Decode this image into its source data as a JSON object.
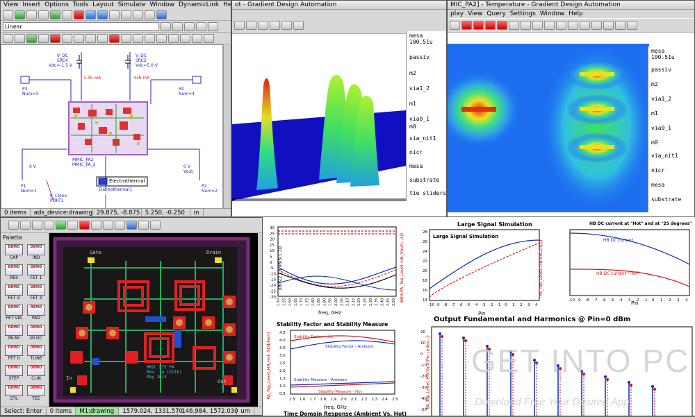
{
  "schematic": {
    "menu": [
      "View",
      "Insert",
      "Options",
      "Tools",
      "Layout",
      "Simulate",
      "Window",
      "DynamicLink",
      "Help"
    ],
    "mode_select": "Linear",
    "labels": {
      "vdc1": "V_DC",
      "src4": "SRC4",
      "vdc1v": "Vdc=-1.5 V",
      "vdc2": "V_DC",
      "src2": "SRC2",
      "vdc2v": "Vdc=5.0 V",
      "cur1": "1.35 mA",
      "cur2": "436 mA",
      "p3": "P3",
      "num3": "Num=3",
      "p4": "P4",
      "num4": "Num=4",
      "p1": "P1",
      "num1": "Num=1",
      "p2": "P2",
      "num2": "Num=2",
      "mmic": "MMIC_PA2",
      "mmic2": "MMIC_PA_2",
      "electro": "Electrothermal",
      "electro_sub": "Electrothermal1",
      "vin": "0 V",
      "vout": "0 V",
      "vout_lbl": "Vout",
      "p1tone": "P_1Tone",
      "port1": "PORT1"
    },
    "status": [
      "0 items",
      "ads_device:drawing",
      "29.875, -8.875",
      "5.250, -0.250",
      "in"
    ]
  },
  "thermal3d": {
    "title": "ot - Gradient Design Automation",
    "layers": [
      "mesa",
      "100.51u",
      "passiv",
      "m2",
      "via1_2",
      "m1",
      "via0_1",
      "m0",
      "via_nit1",
      "nicr",
      "mesa",
      "substrate",
      "tie sliders"
    ]
  },
  "temperature": {
    "title": "MIC_PA2] - Temperature - Gradient Design Automation",
    "menu": [
      "play",
      "View",
      "Query",
      "Settings",
      "Window",
      "Help"
    ],
    "layers": [
      "mesa",
      "100.51u",
      "passiv",
      "m2",
      "via1_2",
      "m1",
      "via0_1",
      "m0",
      "via_nit1",
      "nicr",
      "mesa",
      "substrate"
    ]
  },
  "layout": {
    "palette_title": "Palette",
    "palette": [
      {
        "icon": "DEMO",
        "label": "CAP"
      },
      {
        "icon": "DEMO",
        "label": "IND"
      },
      {
        "icon": "DEMO",
        "label": "RES"
      },
      {
        "icon": "DEMO",
        "label": "FET 1"
      },
      {
        "icon": "DEMO",
        "label": "FET 2"
      },
      {
        "icon": "DEMO",
        "label": "FET 3"
      },
      {
        "icon": "DEMO",
        "label": "FET VIA"
      },
      {
        "icon": "DEMO",
        "label": "PAD"
      },
      {
        "icon": "DEMO",
        "label": "MI-MI"
      },
      {
        "icon": "DEMO",
        "label": "MI DC"
      },
      {
        "icon": "DEMO",
        "label": "FET 0"
      },
      {
        "icon": "DEMO",
        "label": "TLINE"
      },
      {
        "icon": "DEMO",
        "label": "STEP"
      },
      {
        "icon": "DEMO",
        "label": "CLIN"
      },
      {
        "icon": "DEMO",
        "label": "CFIL"
      },
      {
        "icon": "DEMO",
        "label": "TEE"
      }
    ],
    "chip_text": [
      "Gate",
      "Drain",
      "In",
      "Out",
      "MMIC LTE PA",
      "Rev. 2a (Silk)",
      "May 2013"
    ],
    "status": [
      "Select: Enter",
      "0 items",
      "M1:drawing",
      "1579.024, 1331.570",
      "146.984, 1572.030",
      "um"
    ]
  },
  "plots": {
    "p1": {
      "xlabel": "freq, GHz",
      "ticks_x": [
        "1.50",
        "1.55",
        "1.60",
        "1.65",
        "1.70",
        "1.75",
        "1.80",
        "1.85",
        "1.90",
        "1.95",
        "2.00",
        "2.05",
        "2.10",
        "2.15",
        "2.20",
        "2.25",
        "2.30",
        "2.35",
        "2.40",
        "2.45",
        "2.50"
      ],
      "ticks_y": [
        "30",
        "25",
        "20",
        "15",
        "10",
        "5",
        "0",
        "-5",
        "-10",
        "-15",
        "-20",
        "-25",
        "-30"
      ],
      "ylabel": "dB(S(2,1))\ndB(S(1,1))"
    },
    "p2": {
      "title": "Large Signal Simulation",
      "inner_title": "Large Signal Simulation",
      "xlabel": "Pin",
      "ticks_x": [
        "-10",
        "-9",
        "-8",
        "-7",
        "-6",
        "-5",
        "-4",
        "-3",
        "-2",
        "-1",
        "0",
        "1",
        "2",
        "3",
        "4"
      ],
      "ticks_y": [
        "28",
        "26",
        "24",
        "22",
        "20",
        "18",
        "16",
        "14"
      ],
      "ylabel": "dBm(PA_Top_Level..HB_Vout[::,1])"
    },
    "p3": {
      "title": "HB DC current at \"Hot\" and at \"25 degrees\"",
      "leg1": "HB DC current",
      "leg2": "HB DC current \"HOT\"",
      "xlabel": "Pin",
      "ticks_x": [
        "-10",
        "-9",
        "-8",
        "-7",
        "-6",
        "-5",
        "-4",
        "-3",
        "-2",
        "-1",
        "0",
        "1",
        "2",
        "3",
        "4"
      ],
      "ylabel": "PA_Top_Level..HB.SRC2.i[0]"
    },
    "p4": {
      "title": "Stability Factor and Stability Measure",
      "leg1": "Stability Factor - Hot",
      "leg2": "Stability Factor - Ambient",
      "leg3": "Stability Measure - Ambient",
      "leg4": "Stability Measure - Hot",
      "xlabel": "freq, GHz",
      "ticks_x": [
        "1.5",
        "1.6",
        "1.7",
        "1.8",
        "1.9",
        "2.0",
        "2.1",
        "2.2",
        "2.3",
        "2.4",
        "2.5"
      ],
      "ticks_y": [
        "4.5",
        "4.0",
        "3.5",
        "3.0",
        "2.5",
        "2.0",
        "1.5",
        "1.0",
        "0.5"
      ],
      "ylabel": "PA_Top_Level_HB_Hot..StabFact1",
      "bottom_title": "Time Domain Response (Ambient Vs. Hot)"
    },
    "p5": {
      "title": "Output Fundamental and Harmonics @ Pin=0 dBm",
      "ticks_y": [
        "20",
        "10",
        "0",
        "-10",
        "-20",
        "-30",
        "-40",
        "-50"
      ],
      "ylabel": "PA_Top_Level..HB.Vout[Pin_index,::]"
    }
  },
  "watermark": {
    "line1": "GET INTO PC",
    "line2": "Download Free Your Desired App"
  },
  "colors": {
    "red": "#d01010",
    "blue": "#1028c0",
    "black": "#000000",
    "chipbg": "#000000",
    "frame": "#7a2a7a"
  }
}
